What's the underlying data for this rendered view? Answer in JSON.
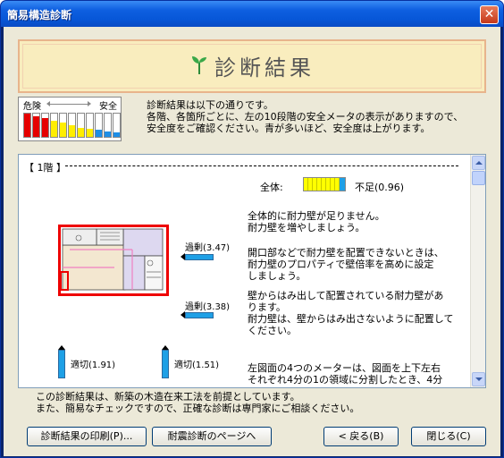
{
  "window": {
    "title": "簡易構造診断",
    "close_glyph": "✕"
  },
  "banner": {
    "title": "診断結果",
    "icon": "sprout-icon"
  },
  "legend": {
    "danger_label": "危険",
    "safe_label": "安全",
    "levels": [
      {
        "fill": 1.0,
        "color": "#e60000"
      },
      {
        "fill": 0.9,
        "color": "#e60000"
      },
      {
        "fill": 0.8,
        "color": "#e60000"
      },
      {
        "fill": 0.7,
        "color": "#ffee00"
      },
      {
        "fill": 0.6,
        "color": "#ffee00"
      },
      {
        "fill": 0.5,
        "color": "#ffee00"
      },
      {
        "fill": 0.4,
        "color": "#ffee00"
      },
      {
        "fill": 0.35,
        "color": "#ffee00"
      },
      {
        "fill": 0.3,
        "color": "#1e8ee6"
      },
      {
        "fill": 0.25,
        "color": "#1e8ee6"
      },
      {
        "fill": 0.2,
        "color": "#1e8ee6"
      }
    ]
  },
  "intro": {
    "line1": "診断結果は以下の通りです。",
    "line2": "各階、各箇所ごとに、左の10段階の安全メータの表示がありますので、",
    "line3": "安全度をご確認ください。青が多いほど、安全度は上がります。"
  },
  "panel": {
    "floor_label": "【 1階 】",
    "overall_label": "全体:",
    "overall_value": "不足(0.96)",
    "meters": {
      "top_right": "過剰(3.47)",
      "bottom_right": "過剰(3.38)",
      "left": "適切(1.91)",
      "right": "適切(1.51)"
    },
    "messages": {
      "m1a": "全体的に耐力壁が足りません。",
      "m1b": "耐力壁を増やしましょう。",
      "m2a": "開口部などで耐力壁を配置できないときは、",
      "m2b": "耐力壁のプロパティで壁倍率を高めに設定",
      "m2c": "しましょう。",
      "m3a": "壁からはみ出して配置されている耐力壁があ",
      "m3b": "ります。",
      "m3c": "耐力壁は、壁からはみ出さないように配置して",
      "m3d": "ください。",
      "m4a": "左図面の4つのメーターは、図面を上下左右",
      "m4b": "それぞれ4分の1の領域に分割したとき、4分"
    }
  },
  "footer": {
    "line1": "この診断結果は、新築の木造在来工法を前提としています。",
    "line2": "また、簡易なチェックですので、正確な診断は専門家にご相談ください。"
  },
  "buttons": {
    "print": "診断結果の印刷(P)...",
    "seismic": "耐震診断のページへ",
    "back": "< 戻る(B)",
    "close": "閉じる(C)"
  }
}
